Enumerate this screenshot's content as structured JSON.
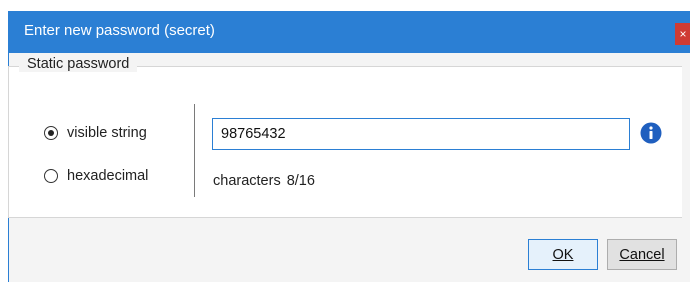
{
  "dialog": {
    "title": "Enter new password (secret)",
    "close_glyph": "×"
  },
  "group": {
    "legend": "Static password"
  },
  "format": {
    "options": [
      {
        "label": "visible string",
        "checked": true
      },
      {
        "label": "hexadecimal",
        "checked": false
      }
    ]
  },
  "password": {
    "value": "98765432"
  },
  "info": {
    "icon": "info-icon",
    "color": "#1f5fbf"
  },
  "length": {
    "label": "characters",
    "count": "8/16"
  },
  "buttons": {
    "ok": "OK",
    "cancel": "Cancel"
  }
}
